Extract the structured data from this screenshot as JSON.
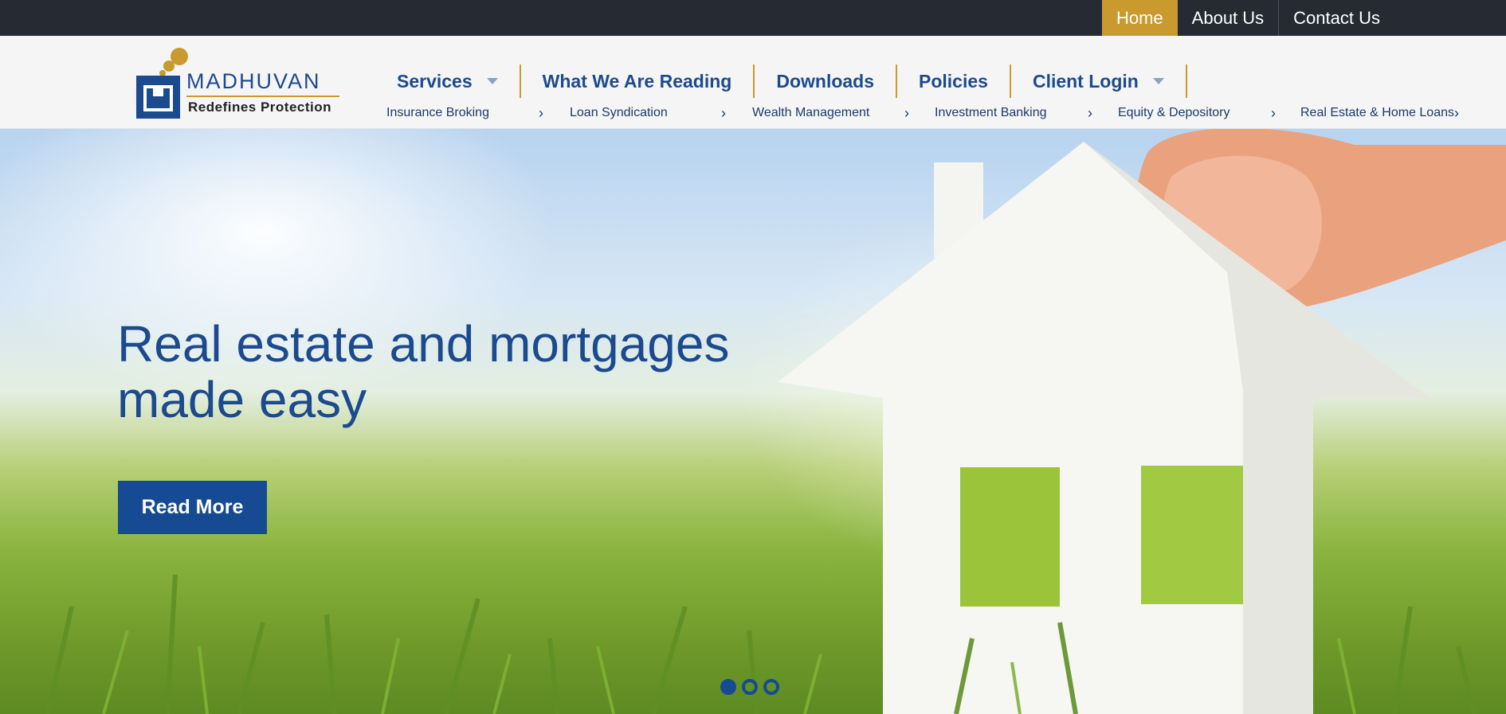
{
  "topbar": {
    "links": [
      {
        "label": "Home",
        "active": true
      },
      {
        "label": "About Us",
        "active": false
      },
      {
        "label": "Contact Us",
        "active": false
      }
    ]
  },
  "logo": {
    "name": "MADHUVAN",
    "tagline": "Redefines Protection"
  },
  "mainnav": {
    "items": [
      {
        "label": "Services",
        "has_dropdown": true
      },
      {
        "label": "What We Are Reading",
        "has_dropdown": false
      },
      {
        "label": "Downloads",
        "has_dropdown": false
      },
      {
        "label": "Policies",
        "has_dropdown": false
      },
      {
        "label": "Client Login",
        "has_dropdown": true
      }
    ]
  },
  "subnav": {
    "items": [
      {
        "label": "Insurance Broking"
      },
      {
        "label": "Loan Syndication"
      },
      {
        "label": "Wealth Management"
      },
      {
        "label": "Investment Banking"
      },
      {
        "label": "Equity & Depository"
      },
      {
        "label": "Real Estate & Home Loans"
      }
    ],
    "chevron": "›"
  },
  "hero": {
    "title_line1": "Real estate and mortgages",
    "title_line2": "made easy",
    "button_label": "Read More",
    "slides": 3,
    "active_slide": 1
  },
  "colors": {
    "brand_blue": "#1c4a8f",
    "accent_gold": "#c99a2e",
    "topbar_bg": "#252a33"
  }
}
